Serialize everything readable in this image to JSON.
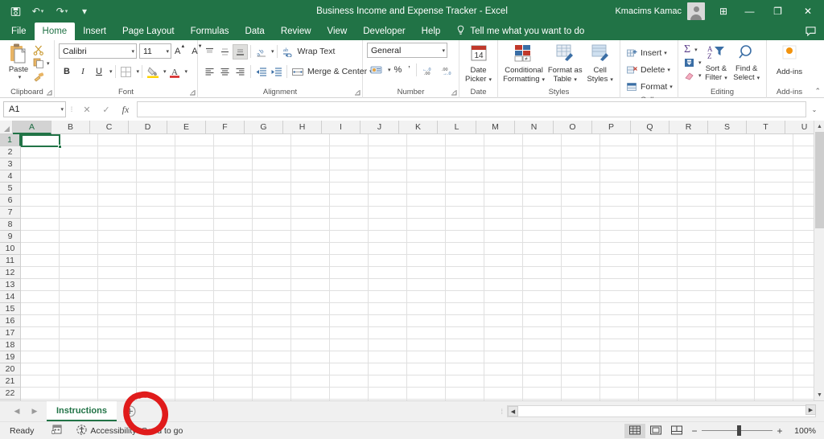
{
  "titlebar": {
    "document_title": "Business Income and Expense Tracker  -  Excel",
    "account_name": "Kmacims Kamac",
    "save_icon": "save-icon",
    "undo_label": "↶",
    "redo_label": "↷",
    "qat_more": "▾",
    "ribbon_display_icon": "⊞",
    "minimize_label": "—",
    "restore_label": "❐",
    "close_label": "✕"
  },
  "ribbon_tabs": [
    {
      "label": "File",
      "active": false
    },
    {
      "label": "Home",
      "active": true
    },
    {
      "label": "Insert",
      "active": false
    },
    {
      "label": "Page Layout",
      "active": false
    },
    {
      "label": "Formulas",
      "active": false
    },
    {
      "label": "Data",
      "active": false
    },
    {
      "label": "Review",
      "active": false
    },
    {
      "label": "View",
      "active": false
    },
    {
      "label": "Developer",
      "active": false
    },
    {
      "label": "Help",
      "active": false
    }
  ],
  "tellme": {
    "label": "Tell me what you want to do",
    "icon": "lightbulb-icon"
  },
  "comment_icon": "comment-icon",
  "ribbon": {
    "clipboard": {
      "group_label": "Clipboard",
      "paste_label": "Paste",
      "cut_label": "Cut",
      "copy_label": "Copy",
      "format_painter_label": "Format Painter",
      "dialog_launcher": "⌐"
    },
    "font": {
      "group_label": "Font",
      "font_name": "Calibri",
      "font_size": "11",
      "grow_font": "A",
      "shrink_font": "A",
      "bold": "B",
      "italic": "I",
      "underline": "U",
      "borders": "▦",
      "fill_color": "A",
      "font_color": "A",
      "dialog_launcher": "⌐"
    },
    "alignment": {
      "group_label": "Alignment",
      "wrap_text_label": "Wrap Text",
      "merge_center_label": "Merge & Center",
      "align_top": "≡",
      "align_middle": "≡",
      "align_bottom": "≡",
      "orientation": "↗",
      "align_left": "≡",
      "align_center": "≡",
      "align_right": "≡",
      "decrease_indent": "⇤",
      "increase_indent": "⇥",
      "dialog_launcher": "⌐"
    },
    "number": {
      "group_label": "Number",
      "format_value": "General",
      "accounting": "$",
      "percent": "%",
      "comma": "ʼ",
      "increase_decimal": "•.00",
      "decrease_decimal": ".00•",
      "dialog_launcher": "⌐"
    },
    "date": {
      "group_label": "Date",
      "date_picker_line1": "Date",
      "date_picker_line2": "Picker",
      "calendar_day": "14"
    },
    "styles": {
      "group_label": "Styles",
      "conditional_line1": "Conditional",
      "conditional_line2": "Formatting",
      "format_table_line1": "Format as",
      "format_table_line2": "Table",
      "cell_styles_line1": "Cell",
      "cell_styles_line2": "Styles"
    },
    "cells": {
      "group_label": "Cells",
      "insert_label": "Insert",
      "delete_label": "Delete",
      "format_label": "Format"
    },
    "editing": {
      "group_label": "Editing",
      "autosum": "Σ",
      "fill": "⬇",
      "clear": "✐",
      "sort_filter_line1": "Sort &",
      "sort_filter_line2": "Filter",
      "find_select_line1": "Find &",
      "find_select_line2": "Select"
    },
    "addins": {
      "group_label": "Add-ins",
      "button_label": "Add-ins"
    },
    "collapse_ribbon": "⌃"
  },
  "formula_bar": {
    "name_box_value": "A1",
    "cancel_icon": "✕",
    "enter_icon": "✓",
    "function_icon": "fx",
    "formula_value": "",
    "expand_icon": "⌄"
  },
  "grid": {
    "columns": [
      "A",
      "B",
      "C",
      "D",
      "E",
      "F",
      "G",
      "H",
      "I",
      "J",
      "K",
      "L",
      "M",
      "N",
      "O",
      "P",
      "Q",
      "R",
      "S",
      "T",
      "U"
    ],
    "rows": [
      1,
      2,
      3,
      4,
      5,
      6,
      7,
      8,
      9,
      10,
      11,
      12,
      13,
      14,
      15,
      16,
      17,
      18,
      19,
      20,
      21,
      22
    ],
    "selected_cell": "A1",
    "selected_column": "A",
    "selected_row": 1
  },
  "sheet_bar": {
    "nav_first": "◀",
    "nav_last": "▶",
    "tabs": [
      {
        "label": "Instructions",
        "active": true
      }
    ],
    "add_sheet_label": "⊕",
    "hscroll_left": "◀",
    "hscroll_right": "▶"
  },
  "status_bar": {
    "mode": "Ready",
    "macro_record_icon": "record-macro-icon",
    "accessibility_text": "Accessibility: Good to go",
    "accessibility_icon": "accessibility-icon",
    "view_normal": "▦",
    "view_page_layout": "▣",
    "view_page_break": "⊞",
    "zoom_out": "−",
    "zoom_in": "+",
    "zoom_value": "100%"
  },
  "annotation": {
    "type": "hand-drawn-circle",
    "color": "#e01b1b",
    "target": "add-sheet-button"
  },
  "colors": {
    "excel_green": "#217346",
    "ribbon_bg": "#ffffff",
    "grid_line": "#e0e0e0",
    "header_bg": "#f2f2f2",
    "annotation_red": "#e01b1b"
  }
}
